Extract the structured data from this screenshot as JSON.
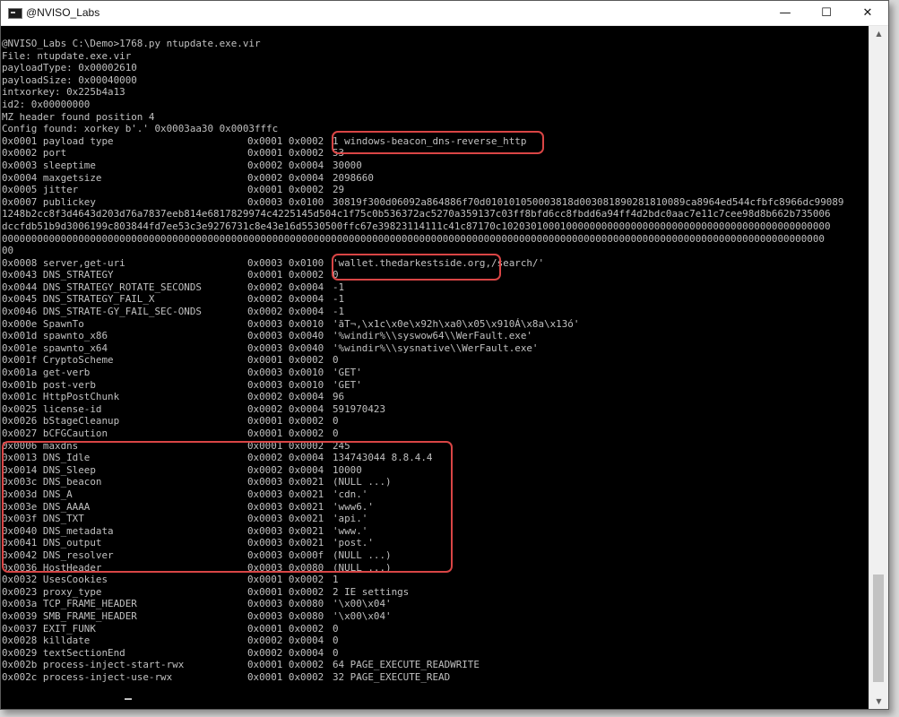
{
  "window": {
    "title": "@NVISO_Labs",
    "minimize_glyph": "—",
    "maximize_glyph": "☐",
    "close_glyph": "✕"
  },
  "icons": {
    "app": "console-app-icon",
    "minimize": "minimize-icon",
    "maximize": "maximize-icon",
    "close": "close-icon",
    "scroll_up": "scroll-up-arrow-icon",
    "scroll_down": "scroll-down-arrow-icon"
  },
  "colors": {
    "console_bg": "#000000",
    "console_text": "#c0c0c0",
    "highlight_box": "#d94545",
    "titlebar_bg": "#ffffff"
  },
  "scrollbar": {
    "up_glyph": "▲",
    "down_glyph": "▼"
  },
  "console": {
    "header_lines": [
      "@NVISO_Labs C:\\Demo>1768.py ntupdate.exe.vir",
      "File: ntupdate.exe.vir",
      "payloadType: 0x00002610",
      "payloadSize: 0x00040000",
      "intxorkey: 0x225b4a13",
      "id2: 0x00000000",
      "MZ header found position 4",
      "Config found: xorkey b'.' 0x0003aa30 0x0003fffc"
    ],
    "rows_a": [
      {
        "name": "0x0001 payload type",
        "type": "0x0001 0x0002",
        "value": "1 windows-beacon_dns-reverse_http"
      },
      {
        "name": "0x0002 port",
        "type": "0x0001 0x0002",
        "value": "53"
      },
      {
        "name": "0x0003 sleeptime",
        "type": "0x0002 0x0004",
        "value": "30000"
      },
      {
        "name": "0x0004 maxgetsize",
        "type": "0x0002 0x0004",
        "value": "2098660"
      },
      {
        "name": "0x0005 jitter",
        "type": "0x0001 0x0002",
        "value": "29"
      },
      {
        "name": "0x0007 publickey",
        "type": "0x0003 0x0100",
        "value": "30819f300d06092a864886f70d010101050003818d003081890281810089ca8964ed544cfbfc8966dc99089"
      }
    ],
    "wrap_lines": [
      "1248b2cc8f3d4643d203d76a7837eeb814e6817829974c4225145d504c1f75c0b536372ac5270a359137c03ff8bfd6cc8fbdd6a94ff4d2bdc0aac7e11c7cee98d8b662b735006",
      "dccfdb51b9d3006199c803844fd7ee53c3e9276731c8e43e16d5530500ffc67e39823114111c41c87170c10203010001000000000000000000000000000000000000000000000",
      "00000000000000000000000000000000000000000000000000000000000000000000000000000000000000000000000000000000000000000000000000000000000000000000",
      "00"
    ],
    "rows_b": [
      {
        "name": "0x0008 server,get-uri",
        "type": "0x0003 0x0100",
        "value": "'wallet.thedarkestside.org,/search/'"
      },
      {
        "name": "0x0043 DNS_STRATEGY",
        "type": "0x0001 0x0002",
        "value": "0"
      },
      {
        "name": "0x0044 DNS_STRATEGY_ROTATE_SECONDS",
        "type": "0x0002 0x0004",
        "value": "-1"
      },
      {
        "name": "0x0045 DNS_STRATEGY_FAIL_X",
        "type": "0x0002 0x0004",
        "value": "-1"
      },
      {
        "name": "0x0046 DNS_STRATE-GY_FAIL_SEC-ONDS",
        "type": "0x0002 0x0004",
        "value": "-1"
      },
      {
        "name": "0x000e SpawnTo",
        "type": "0x0003 0x0010",
        "value": "'ãT¬,\\x1c\\x0e\\x92h\\xa0\\x05\\x910Á\\x8a\\x13ó'"
      },
      {
        "name": "0x001d spawnto_x86",
        "type": "0x0003 0x0040",
        "value": "'%windir%\\\\syswow64\\\\WerFault.exe'"
      },
      {
        "name": "0x001e spawnto_x64",
        "type": "0x0003 0x0040",
        "value": "'%windir%\\\\sysnative\\\\WerFault.exe'"
      },
      {
        "name": "0x001f CryptoScheme",
        "type": "0x0001 0x0002",
        "value": "0"
      },
      {
        "name": "0x001a get-verb",
        "type": "0x0003 0x0010",
        "value": "'GET'"
      },
      {
        "name": "0x001b post-verb",
        "type": "0x0003 0x0010",
        "value": "'GET'"
      },
      {
        "name": "0x001c HttpPostChunk",
        "type": "0x0002 0x0004",
        "value": "96"
      },
      {
        "name": "0x0025 license-id",
        "type": "0x0002 0x0004",
        "value": "591970423"
      },
      {
        "name": "0x0026 bStageCleanup",
        "type": "0x0001 0x0002",
        "value": "0"
      },
      {
        "name": "0x0027 bCFGCaution",
        "type": "0x0001 0x0002",
        "value": "0"
      },
      {
        "name": "0x0006 maxdns",
        "type": "0x0001 0x0002",
        "value": "245"
      },
      {
        "name": "0x0013 DNS_Idle",
        "type": "0x0002 0x0004",
        "value": "134743044 8.8.4.4"
      },
      {
        "name": "0x0014 DNS_Sleep",
        "type": "0x0002 0x0004",
        "value": "10000"
      },
      {
        "name": "0x003c DNS_beacon",
        "type": "0x0003 0x0021",
        "value": "(NULL ...)"
      },
      {
        "name": "0x003d DNS_A",
        "type": "0x0003 0x0021",
        "value": "'cdn.'"
      },
      {
        "name": "0x003e DNS_AAAA",
        "type": "0x0003 0x0021",
        "value": "'www6.'"
      },
      {
        "name": "0x003f DNS_TXT",
        "type": "0x0003 0x0021",
        "value": "'api.'"
      },
      {
        "name": "0x0040 DNS_metadata",
        "type": "0x0003 0x0021",
        "value": "'www.'"
      },
      {
        "name": "0x0041 DNS_output",
        "type": "0x0003 0x0021",
        "value": "'post.'"
      },
      {
        "name": "0x0042 DNS_resolver",
        "type": "0x0003 0x000f",
        "value": "(NULL ...)"
      },
      {
        "name": "0x0036 HostHeader",
        "type": "0x0003 0x0080",
        "value": "(NULL ...)"
      },
      {
        "name": "0x0032 UsesCookies",
        "type": "0x0001 0x0002",
        "value": "1"
      },
      {
        "name": "0x0023 proxy_type",
        "type": "0x0001 0x0002",
        "value": "2 IE settings"
      },
      {
        "name": "0x003a TCP_FRAME_HEADER",
        "type": "0x0003 0x0080",
        "value": "'\\x00\\x04'"
      },
      {
        "name": "0x0039 SMB_FRAME_HEADER",
        "type": "0x0003 0x0080",
        "value": "'\\x00\\x04'"
      },
      {
        "name": "0x0037 EXIT_FUNK",
        "type": "0x0001 0x0002",
        "value": "0"
      },
      {
        "name": "0x0028 killdate",
        "type": "0x0002 0x0004",
        "value": "0"
      },
      {
        "name": "0x0029 textSectionEnd",
        "type": "0x0002 0x0004",
        "value": "0"
      },
      {
        "name": "0x002b process-inject-start-rwx",
        "type": "0x0001 0x0002",
        "value": "64 PAGE_EXECUTE_READWRITE"
      },
      {
        "name": "0x002c process-inject-use-rwx",
        "type": "0x0001 0x0002",
        "value": "32 PAGE_EXECUTE_READ"
      }
    ]
  }
}
